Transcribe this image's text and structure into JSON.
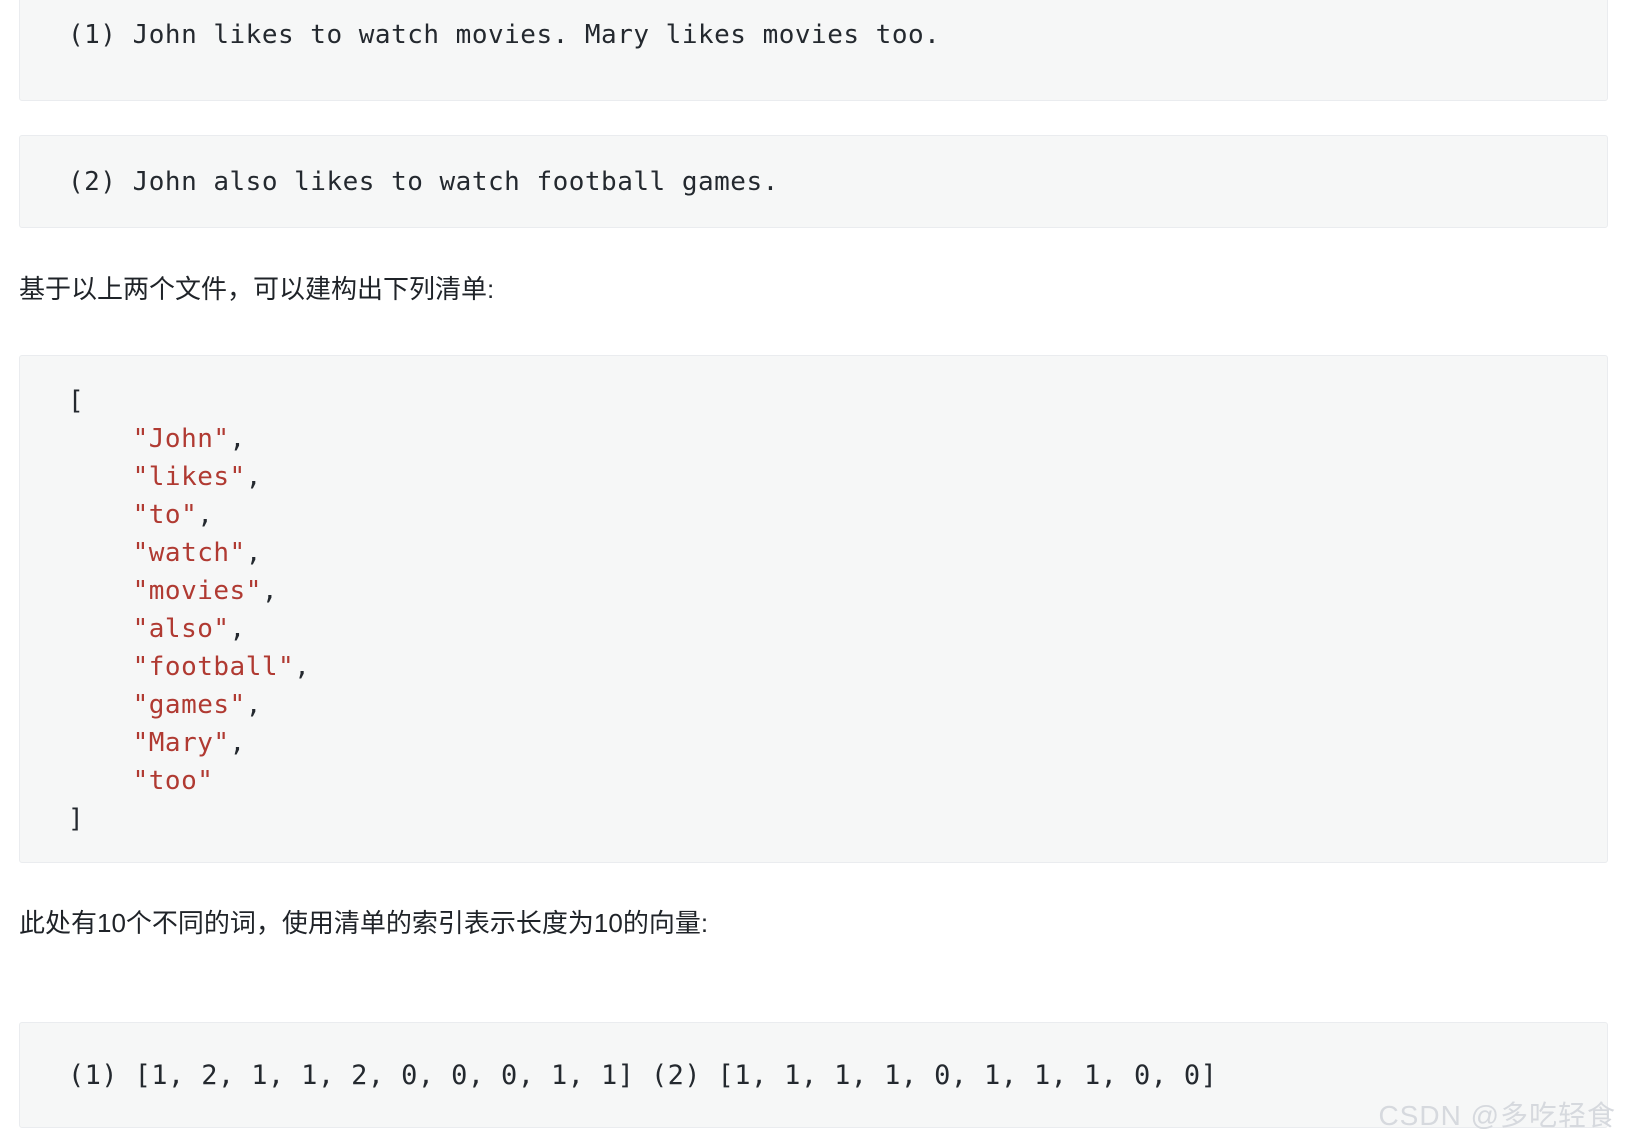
{
  "documents": {
    "doc1": "(1) John likes to watch movies. Mary likes movies too.",
    "doc2": "(2) John also likes to watch football games."
  },
  "prose": {
    "intro": "基于以上两个文件，可以建构出下列清单:",
    "vector_note": "此处有10个不同的词，使用清单的索引表示长度为10的向量:"
  },
  "vocabulary_block": {
    "open_bracket": "[",
    "close_bracket": "]",
    "indent": "    ",
    "quote": "\"",
    "comma": ",",
    "items": [
      {
        "word": "John",
        "comma": ","
      },
      {
        "word": "likes",
        "comma": ","
      },
      {
        "word": "to",
        "comma": ","
      },
      {
        "word": "watch",
        "comma": ","
      },
      {
        "word": "movies",
        "comma": ","
      },
      {
        "word": "also",
        "comma": ","
      },
      {
        "word": "football",
        "comma": ","
      },
      {
        "word": "games",
        "comma": ","
      },
      {
        "word": "Mary",
        "comma": ","
      },
      {
        "word": "too",
        "comma": ""
      }
    ]
  },
  "vectors": {
    "line": "(1) [1, 2, 1, 1, 2, 0, 0, 0, 1, 1] (2) [1, 1, 1, 1, 0, 1, 1, 1, 0, 0]",
    "vector_1_label": "(1)",
    "vector_1": [
      1,
      2,
      1,
      1,
      2,
      0,
      0,
      0,
      1,
      1
    ],
    "vector_2_label": "(2)",
    "vector_2": [
      1,
      1,
      1,
      1,
      0,
      1,
      1,
      1,
      0,
      0
    ]
  },
  "watermark": {
    "text": "CSDN @多吃轻食"
  },
  "colors": {
    "code_background": "#f6f7f7",
    "code_border": "#eaecef",
    "string_red": "#b03a32",
    "text": "#24292f",
    "watermark": "#d6d9de"
  }
}
